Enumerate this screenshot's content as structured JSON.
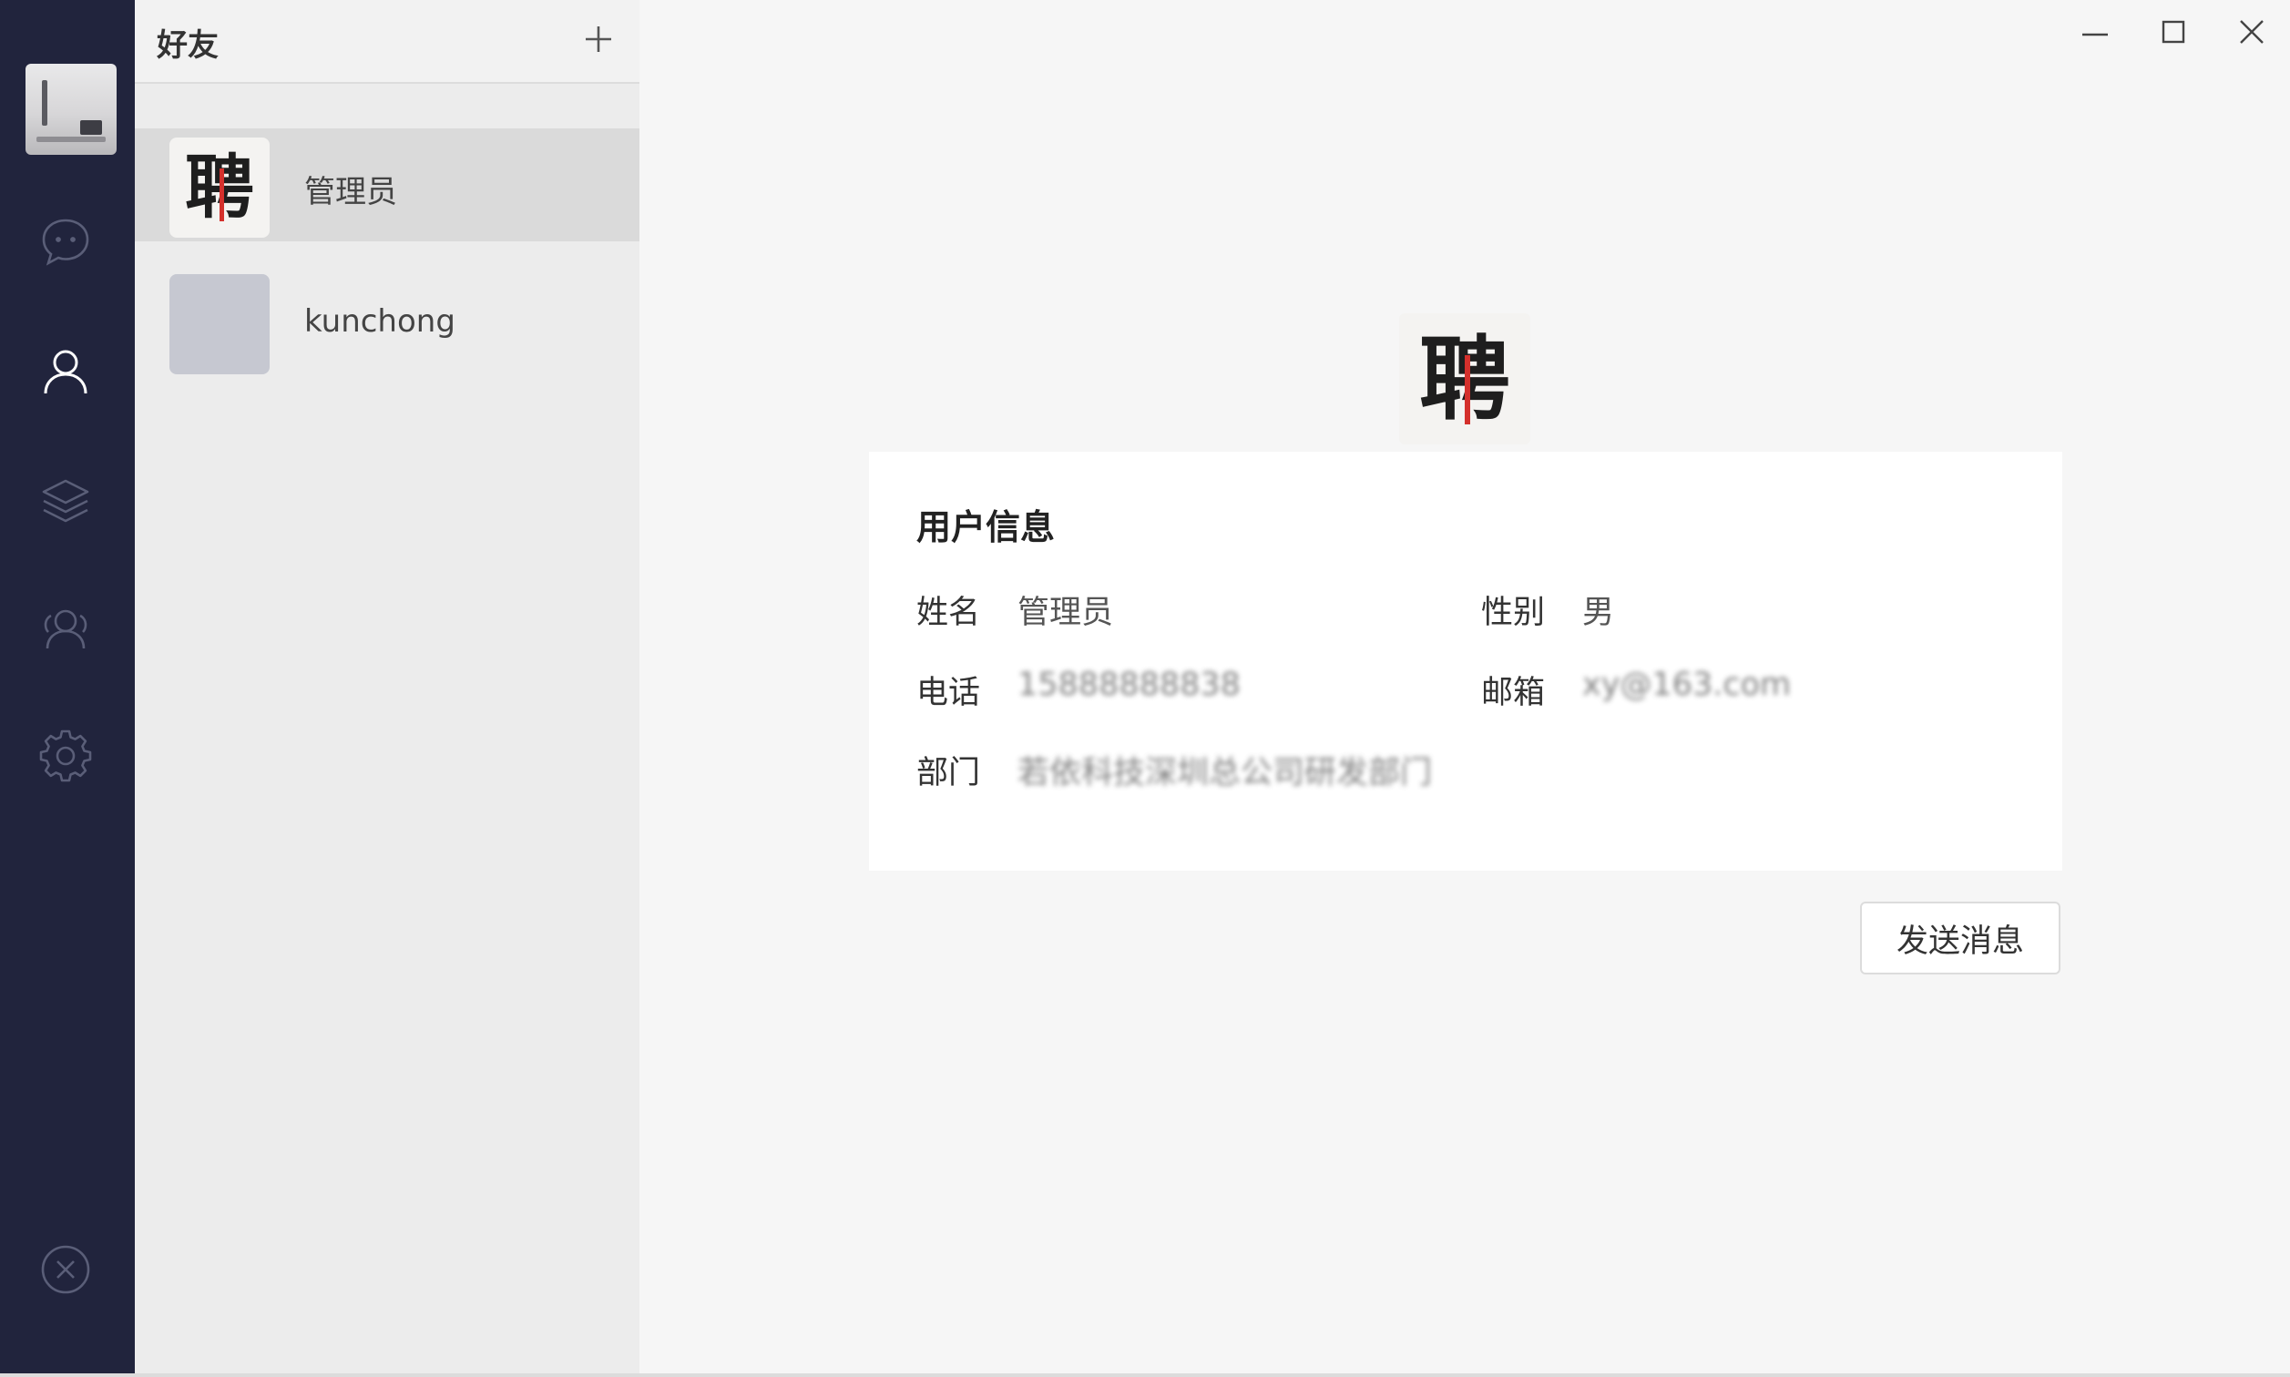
{
  "sidebar": {
    "icons": [
      {
        "name": "chat-icon"
      },
      {
        "name": "contacts-icon"
      },
      {
        "name": "layers-icon"
      },
      {
        "name": "group-icon"
      },
      {
        "name": "settings-icon"
      },
      {
        "name": "logout-icon"
      }
    ],
    "active_index": 1
  },
  "friends_panel": {
    "title": "好友",
    "add_icon": "plus-icon",
    "items": [
      {
        "name": "管理员",
        "avatar": "聘",
        "selected": true
      },
      {
        "name": "kunchong",
        "avatar": "",
        "selected": false
      }
    ]
  },
  "window_controls": {
    "minimize_icon": "minimize-icon",
    "maximize_icon": "maximize-icon",
    "close_icon": "close-icon"
  },
  "profile": {
    "avatar_char": "聘",
    "card_title": "用户信息",
    "name_label": "姓名",
    "name_value": "管理员",
    "gender_label": "性别",
    "gender_value": "男",
    "phone_label": "电话",
    "phone_value": "15888888838",
    "email_label": "邮箱",
    "email_value": "xy@163.com",
    "dept_label": "部门",
    "dept_value": "若依科技深圳总公司研发部门",
    "send_button": "发送消息"
  },
  "colors": {
    "rail_bg": "#21243d",
    "accent_red": "#d4302c",
    "selected_bg": "#dadada"
  }
}
